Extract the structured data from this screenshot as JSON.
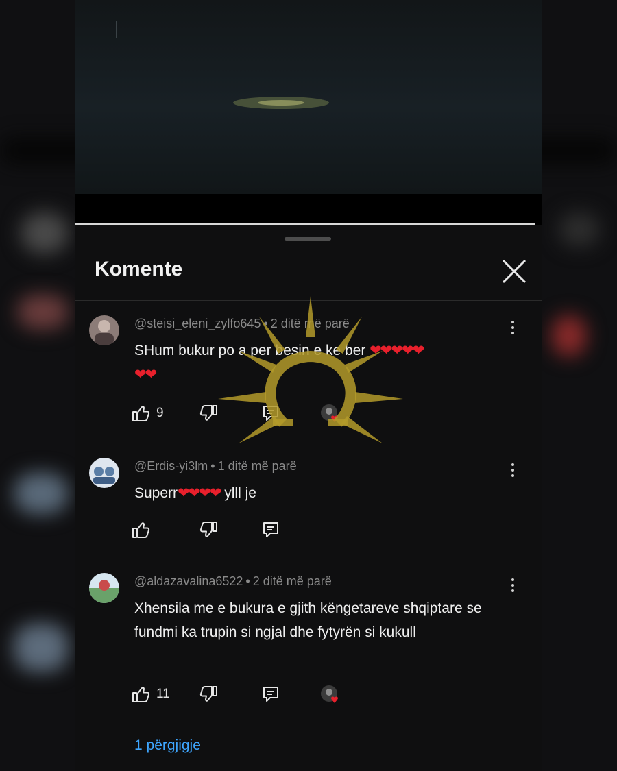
{
  "header": {
    "title": "Komente"
  },
  "comments": [
    {
      "author": "@steisi_eleni_zylfo645",
      "time": "2 ditë më parë",
      "text": "SHum bukur po a per besin e ke ber",
      "hearts_inline": "❤❤❤❤❤",
      "hearts_line2": "❤❤",
      "likes": "9",
      "creator_hearted": true
    },
    {
      "author": "@Erdis-yi3lm",
      "time": "1 ditë më parë",
      "text_before": "Superr",
      "hearts_inline": "❤❤❤❤",
      "text_after": " ylll je",
      "likes": "",
      "creator_hearted": false
    },
    {
      "author": "@aldazavalina6522",
      "time": "2 ditë më parë",
      "text": "Xhensila me e bukura e gjith këngetareve shqiptare se fundmi ka trupin si ngjal dhe fytyrën si kukull",
      "likes": "11",
      "creator_hearted": true
    }
  ],
  "replies_link": "1 përgjigje",
  "separator": "•",
  "colors": {
    "background": "#0f0f10",
    "text": "#eeeeee",
    "meta": "#8a8a8a",
    "link": "#3ea6ff",
    "heart": "#e8202c",
    "watermark": "#b39a2a"
  },
  "icons": [
    "close-icon",
    "more-vert-icon",
    "thumb-up-icon",
    "thumb-down-icon",
    "reply-icon",
    "creator-heart-icon"
  ]
}
